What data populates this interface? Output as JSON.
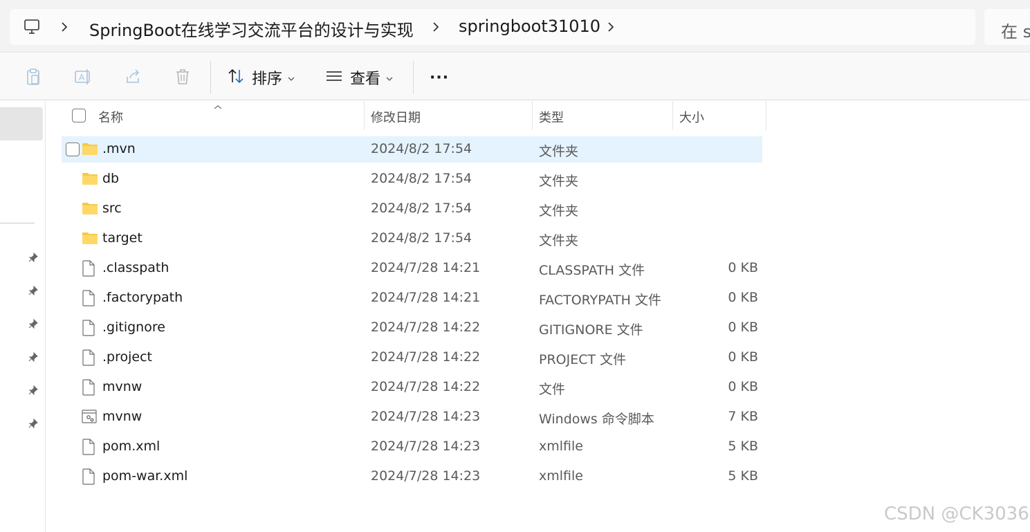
{
  "address_bar": {
    "breadcrumbs": [
      "SpringBoot在线学习交流平台的设计与实现",
      "springboot31010"
    ],
    "search_placeholder": "在 s"
  },
  "toolbar": {
    "sort_label": "排序",
    "view_label": "查看",
    "more_label": "···"
  },
  "columns": {
    "name": "名称",
    "modified": "修改日期",
    "type": "类型",
    "size": "大小"
  },
  "files": [
    {
      "name": ".mvn",
      "modified": "2024/8/2 17:54",
      "type": "文件夹",
      "size": "",
      "icon": "folder-icon",
      "selected": true
    },
    {
      "name": "db",
      "modified": "2024/8/2 17:54",
      "type": "文件夹",
      "size": "",
      "icon": "folder-icon"
    },
    {
      "name": "src",
      "modified": "2024/8/2 17:54",
      "type": "文件夹",
      "size": "",
      "icon": "folder-icon"
    },
    {
      "name": "target",
      "modified": "2024/8/2 17:54",
      "type": "文件夹",
      "size": "",
      "icon": "folder-icon"
    },
    {
      "name": ".classpath",
      "modified": "2024/7/28 14:21",
      "type": "CLASSPATH 文件",
      "size": "0 KB",
      "icon": "file-icon"
    },
    {
      "name": ".factorypath",
      "modified": "2024/7/28 14:21",
      "type": "FACTORYPATH 文件",
      "size": "0 KB",
      "icon": "file-icon"
    },
    {
      "name": ".gitignore",
      "modified": "2024/7/28 14:22",
      "type": "GITIGNORE 文件",
      "size": "0 KB",
      "icon": "file-icon"
    },
    {
      "name": ".project",
      "modified": "2024/7/28 14:22",
      "type": "PROJECT 文件",
      "size": "0 KB",
      "icon": "file-icon"
    },
    {
      "name": "mvnw",
      "modified": "2024/7/28 14:22",
      "type": "文件",
      "size": "0 KB",
      "icon": "file-icon"
    },
    {
      "name": "mvnw",
      "modified": "2024/7/28 14:23",
      "type": "Windows 命令脚本",
      "size": "7 KB",
      "icon": "script-file-icon"
    },
    {
      "name": "pom.xml",
      "modified": "2024/7/28 14:23",
      "type": "xmlfile",
      "size": "5 KB",
      "icon": "file-icon"
    },
    {
      "name": "pom-war.xml",
      "modified": "2024/7/28 14:23",
      "type": "xmlfile",
      "size": "5 KB",
      "icon": "file-icon"
    }
  ],
  "watermark": "CSDN @CK3036"
}
